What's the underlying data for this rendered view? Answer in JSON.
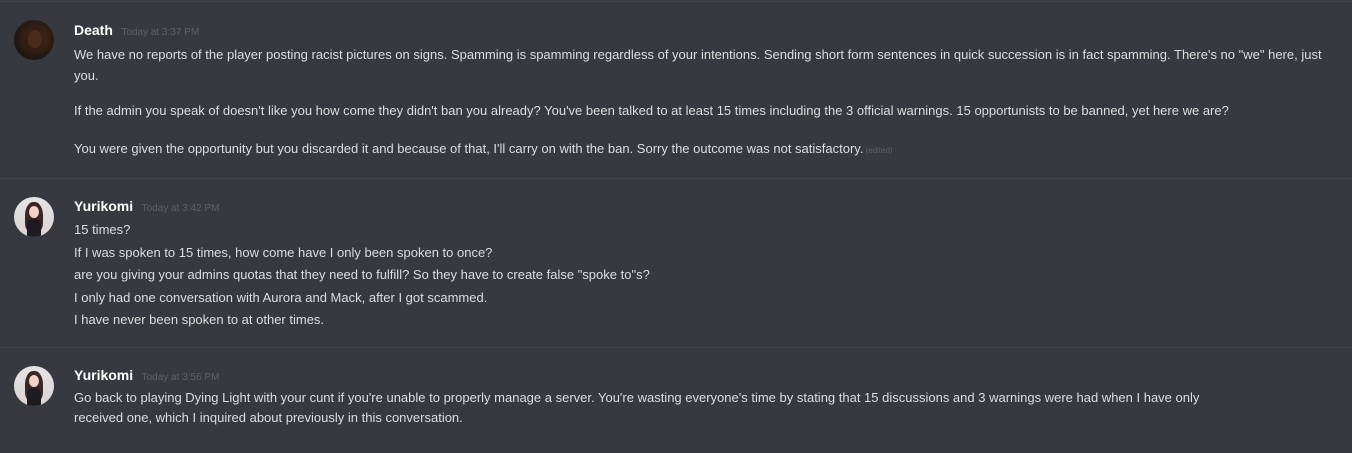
{
  "messages": [
    {
      "author": "Death",
      "timestamp": "Today at 3:37 PM",
      "avatar_icon": "dark-helmet-avatar",
      "paragraphs": [
        "We have no reports of the player posting racist pictures on signs. Spamming is spamming regardless of your intentions. Sending short form sentences in quick succession is in fact spamming. There's no \"we\" here, just you.",
        "If the admin you speak of doesn't like you how come they didn't ban you already? You've been talked to at least 15 times including the 3 official warnings. 15 opportunists to be banned, yet here we are?",
        "You were given the opportunity but you discarded it and because of that, I'll carry on with the ban. Sorry the outcome was not satisfactory."
      ],
      "edited_label": "(edited)"
    },
    {
      "author": "Yurikomi",
      "timestamp": "Today at 3:42 PM",
      "avatar_icon": "anime-girl-avatar",
      "lines": [
        "15 times?",
        "If I was spoken to 15 times, how come have I only been spoken to once?",
        "are you giving your admins quotas that they need to fulfill? So they have to create false \"spoke to\"s?",
        "I only had one conversation with Aurora and Mack, after I got scammed.",
        "I have never been spoken to at other times."
      ]
    },
    {
      "author": "Yurikomi",
      "timestamp": "Today at 3:56 PM",
      "avatar_icon": "anime-girl-avatar",
      "lines": [
        "Go back to playing Dying Light with your cunt if you're unable to properly manage a server. You're wasting everyone's time by stating that 15 discussions and 3 warnings were had when I have only",
        "received one, which I inquired about previously in this conversation."
      ]
    }
  ],
  "colors": {
    "background": "#36393f",
    "divider": "#40444b",
    "username": "#ffffff",
    "text": "#dcddde",
    "timestamp": "#5d6065"
  }
}
